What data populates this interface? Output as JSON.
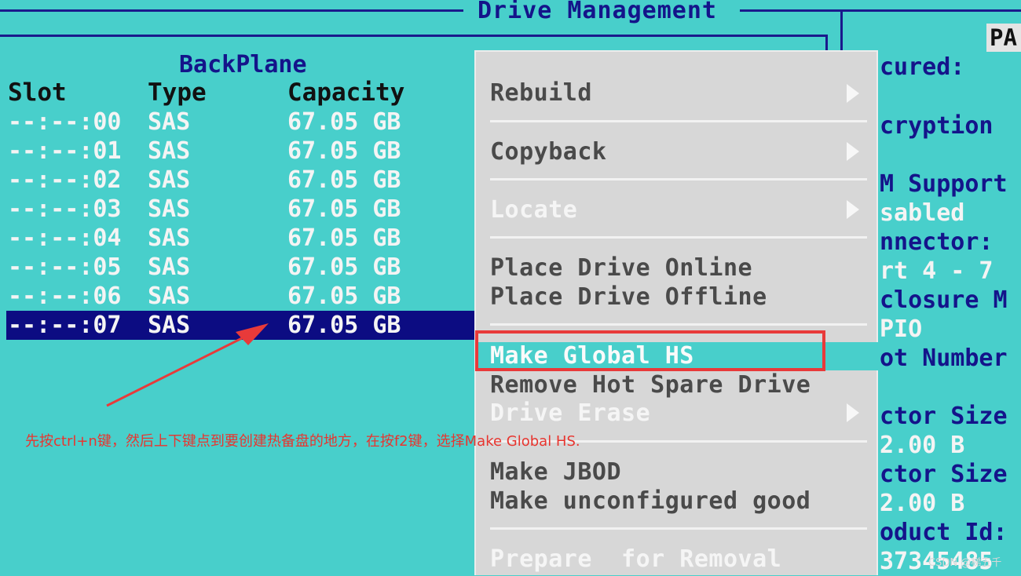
{
  "window": {
    "title": "Drive Management"
  },
  "backplane_label": "BackPlane",
  "table": {
    "headers": {
      "slot": "Slot",
      "type": "Type",
      "capacity": "Capacity"
    },
    "rows": [
      {
        "slot": "--:--:00",
        "type": "SAS",
        "capacity": "67.05 GB"
      },
      {
        "slot": "--:--:01",
        "type": "SAS",
        "capacity": "67.05 GB"
      },
      {
        "slot": "--:--:02",
        "type": "SAS",
        "capacity": "67.05 GB"
      },
      {
        "slot": "--:--:03",
        "type": "SAS",
        "capacity": "67.05 GB"
      },
      {
        "slot": "--:--:04",
        "type": "SAS",
        "capacity": "67.05 GB"
      },
      {
        "slot": "--:--:05",
        "type": "SAS",
        "capacity": "67.05 GB"
      },
      {
        "slot": "--:--:06",
        "type": "SAS",
        "capacity": "67.05 GB"
      },
      {
        "slot": "--:--:07",
        "type": "SAS",
        "capacity": "67.05 GB"
      }
    ],
    "selected_row": 7
  },
  "menu": {
    "rebuild": "Rebuild",
    "copyback": "Copyback",
    "locate": "Locate",
    "place_online": "Place Drive Online",
    "place_offline": "Place Drive Offline",
    "make_global_hs": "Make Global HS",
    "remove_hot_spare": "Remove Hot Spare Drive",
    "drive_erase": "Drive Erase",
    "make_jbod": "Make JBOD",
    "make_unconfigured_good": "Make unconfigured good",
    "prepare_removal": "Prepare  for Removal"
  },
  "properties_panel": {
    "tab_label": "PA",
    "lines": {
      "secured": "cured:",
      "encryption": "cryption",
      "support": "M Support",
      "disabled": "sabled",
      "connector": "nnector:",
      "port": "rt 4 - 7",
      "enclosure": "closure M",
      "pio": "PIO",
      "slot_number": "ot Number",
      "sector_size_1": "ctor Size",
      "sector_value_1": "2.00 B",
      "sector_size_2": "ctor Size",
      "sector_value_2": "2.00 B",
      "product_id": "oduct Id:",
      "product_value": "37345485"
    }
  },
  "annotation": {
    "note": "先按ctrl+n键，然后上下键点到要创建热备盘的地方，在按f2键，选择Make Global HS.",
    "arrow_color": "#e83a3a"
  },
  "watermark": "CSDN @梯五千",
  "colors": {
    "background": "#48cfcb",
    "title_text": "#14148a",
    "selection": "#0c0c82",
    "menu_bg": "#d7d7d7",
    "annotation": "#e83a3a"
  }
}
